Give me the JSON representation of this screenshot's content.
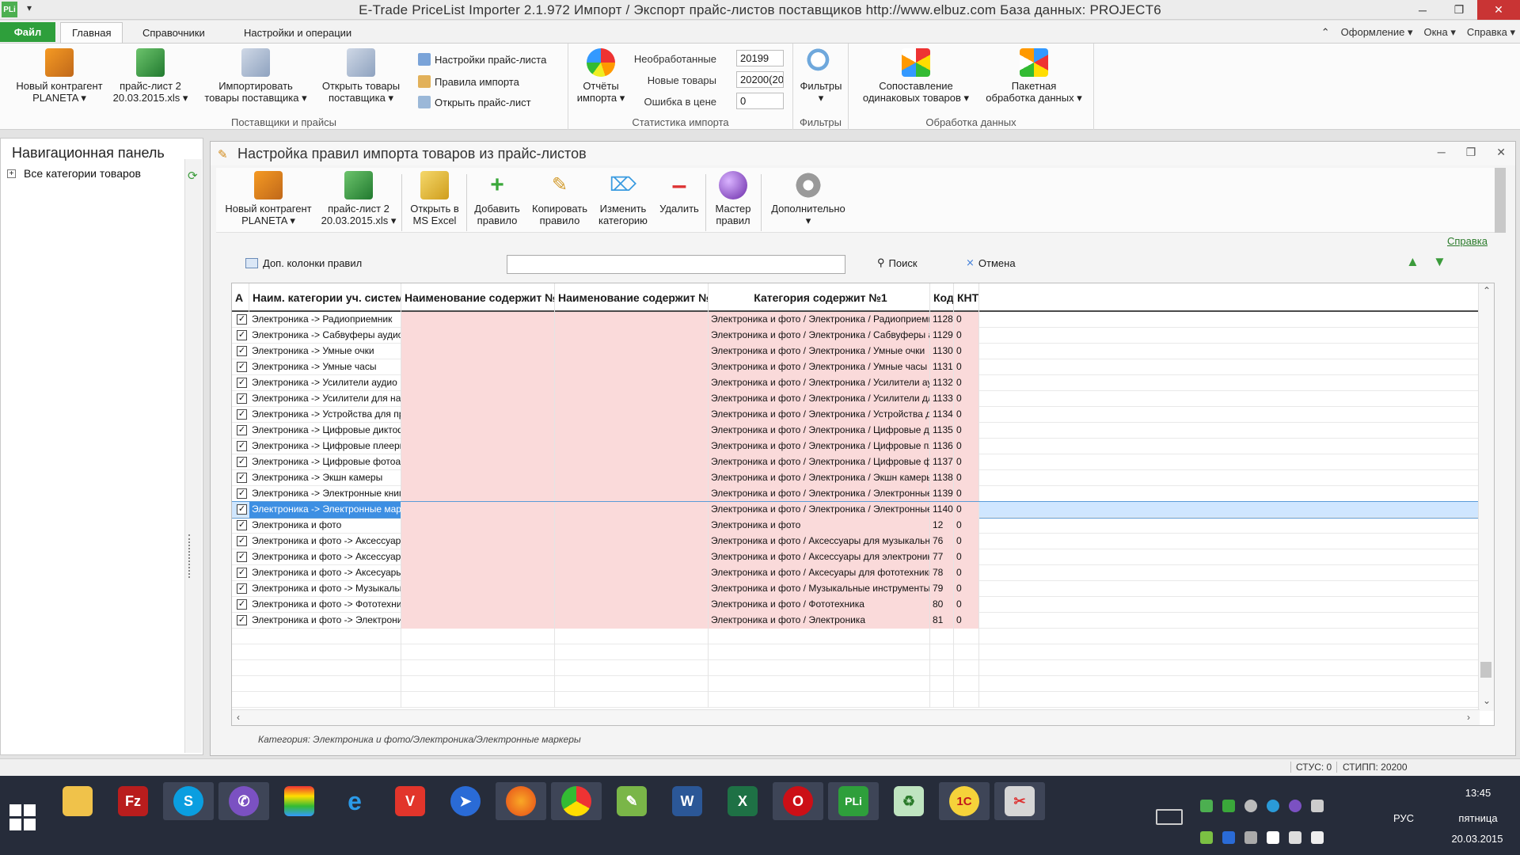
{
  "window": {
    "app_icon": "PLi",
    "title": "E-Trade PriceList Importer 2.1.972     Импорт / Экспорт прайс-листов поставщиков     http://www.elbuz.com     База данных: PROJECT6"
  },
  "ribbon_tabs": {
    "file": "Файл",
    "tabs": [
      "Главная",
      "Справочники",
      "Настройки и операции"
    ],
    "right": [
      "Оформление",
      "Окна",
      "Справка"
    ]
  },
  "ribbon": {
    "suppliers": {
      "new_contractor": "Новый контрагент",
      "new_contractor_sub": "PLANETA",
      "pricelist": "прайс-лист 2",
      "pricelist_sub": "20.03.2015.xls",
      "import_goods": "Импортировать",
      "import_goods_sub": "товары поставщика",
      "open_goods": "Открыть товары",
      "open_goods_sub": "поставщика",
      "pricelist_settings": "Настройки прайс-листа",
      "import_rules": "Правила импорта",
      "open_pricelist": "Открыть прайс-лист",
      "group_label": "Поставщики и прайсы"
    },
    "stats": {
      "reports": "Отчёты",
      "reports_sub": "импорта",
      "unprocessed_label": "Необработанные",
      "unprocessed_value": "20199",
      "new_label": "Новые товары",
      "new_value": "20200(20",
      "price_err_label": "Ошибка в цене",
      "price_err_value": "0",
      "group_label": "Статистика импорта"
    },
    "filters": {
      "btn": "Фильтры",
      "group_label": "Фильтры"
    },
    "processing": {
      "compare": "Сопоставление",
      "compare_sub": "одинаковых товаров",
      "batch": "Пакетная",
      "batch_sub": "обработка данных",
      "group_label": "Обработка данных"
    }
  },
  "nav": {
    "title": "Навигационная панель",
    "root": "Все категории товаров"
  },
  "child": {
    "title": "Настройка правил импорта товаров из прайс-листов",
    "toolbar": {
      "new_contractor": "Новый контрагент",
      "new_contractor_sub": "PLANETA",
      "pricelist": "прайс-лист 2",
      "pricelist_sub": "20.03.2015.xls",
      "open_excel": "Открыть в",
      "open_excel_sub": "MS Excel",
      "add_rule": "Добавить",
      "add_rule_sub": "правило",
      "copy_rule": "Копировать",
      "copy_rule_sub": "правило",
      "change_cat": "Изменить",
      "change_cat_sub": "категорию",
      "delete": "Удалить",
      "wizard": "Мастер",
      "wizard_sub": "правил",
      "extra": "Дополнительно"
    },
    "help": "Справка",
    "filterbar": {
      "extra_cols": "Доп. колонки правил",
      "search": "Поиск",
      "cancel": "Отмена"
    },
    "grid": {
      "headers": [
        "А",
        "Наим. категории уч. системы",
        "Наименование содержит №1",
        "Наименование содержит №2",
        "Категория содержит №1",
        "Код",
        "КНТ"
      ],
      "rows": [
        {
          "name": "Электроника -> Радиоприемник",
          "cat": "Электроника и фото / Электроника / Радиоприемник",
          "code": "1128",
          "knt": "0"
        },
        {
          "name": "Электроника -> Сабвуферы аудио",
          "cat": "Электроника и фото / Электроника / Сабвуферы ауд",
          "code": "1129",
          "knt": "0"
        },
        {
          "name": "Электроника -> Умные очки",
          "cat": "Электроника и фото / Электроника / Умные очки",
          "code": "1130",
          "knt": "0"
        },
        {
          "name": "Электроника -> Умные часы",
          "cat": "Электроника и фото / Электроника / Умные часы",
          "code": "1131",
          "knt": "0"
        },
        {
          "name": "Электроника -> Усилители аудио",
          "cat": "Электроника и фото / Электроника / Усилители ауди",
          "code": "1132",
          "knt": "0"
        },
        {
          "name": "Электроника -> Усилители для нау",
          "cat": "Электроника и фото / Электроника / Усилители для",
          "code": "1133",
          "knt": "0"
        },
        {
          "name": "Электроника -> Устройства для пре",
          "cat": "Электроника и фото / Электроника / Устройства для",
          "code": "1134",
          "knt": "0"
        },
        {
          "name": "Электроника -> Цифровые диктофо",
          "cat": "Электроника и фото / Электроника / Цифровые дикт",
          "code": "1135",
          "knt": "0"
        },
        {
          "name": "Электроника -> Цифровые плееры",
          "cat": "Электроника и фото / Электроника / Цифровые плее",
          "code": "1136",
          "knt": "0"
        },
        {
          "name": "Электроника -> Цифровые фотоап",
          "cat": "Электроника и фото / Электроника / Цифровые фото",
          "code": "1137",
          "knt": "0"
        },
        {
          "name": "Электроника -> Экшн камеры",
          "cat": "Электроника и фото / Электроника / Экшн камеры",
          "code": "1138",
          "knt": "0"
        },
        {
          "name": "Электроника -> Электронные книги",
          "cat": "Электроника и фото / Электроника / Электронные кн",
          "code": "1139",
          "knt": "0"
        },
        {
          "name": "Электроника -> Электронные марк",
          "cat": "Электроника и фото / Электроника / Электронные ма",
          "code": "1140",
          "knt": "0"
        },
        {
          "name": "Электроника и фото",
          "cat": "Электроника и фото",
          "code": "12",
          "knt": "0"
        },
        {
          "name": "Электроника и фото -> Аксессуары",
          "cat": "Электроника и фото / Аксессуары для музыкальных",
          "code": "76",
          "knt": "0"
        },
        {
          "name": "Электроника и фото -> Аксессуары",
          "cat": "Электроника и фото / Аксессуары для электроники",
          "code": "77",
          "knt": "0"
        },
        {
          "name": "Электроника и фото -> Аксесуары д",
          "cat": "Электроника и фото / Аксесуары для фототехники",
          "code": "78",
          "knt": "0"
        },
        {
          "name": "Электроника и фото -> Музыкальны",
          "cat": "Электроника и фото / Музыкальные инструменты",
          "code": "79",
          "knt": "0"
        },
        {
          "name": "Электроника и фото -> Фототехник",
          "cat": "Электроника и фото / Фототехника",
          "code": "80",
          "knt": "0"
        },
        {
          "name": "Электроника и фото -> Электроник",
          "cat": "Электроника и фото / Электроника",
          "code": "81",
          "knt": "0"
        }
      ],
      "selected_index": 12
    },
    "status": "Категория: Электроника и фото/Электроника/Электронные маркеры"
  },
  "statusbar": {
    "stus": "СТУС: 0",
    "stipp": "СТИПП: 20200"
  },
  "taskbar": {
    "lang": "РУС",
    "time": "13:45",
    "day": "пятница",
    "date": "20.03.2015",
    "apps": [
      "explorer-icon",
      "filezilla-icon",
      "skype-icon",
      "viber-icon",
      "stack-icon",
      "ie-icon",
      "vivaldi-icon",
      "swift-icon",
      "firefox-icon",
      "chrome-icon",
      "notepad-icon",
      "word-icon",
      "excel-icon",
      "opera-icon",
      "pli-icon",
      "recycle-icon",
      "1c-icon",
      "tool-icon"
    ],
    "app_labels": {
      "filezilla": "Fz",
      "skype": "S",
      "ie": "e",
      "vivaldi": "V",
      "word": "W",
      "excel": "X",
      "opera": "O",
      "pli": "PLi",
      "onec": "1C"
    }
  },
  "colors": {
    "accent_green": "#2e9f3b",
    "pink_cell": "#fadada",
    "selection": "#cfe6ff",
    "taskbar": "#262c3a"
  }
}
